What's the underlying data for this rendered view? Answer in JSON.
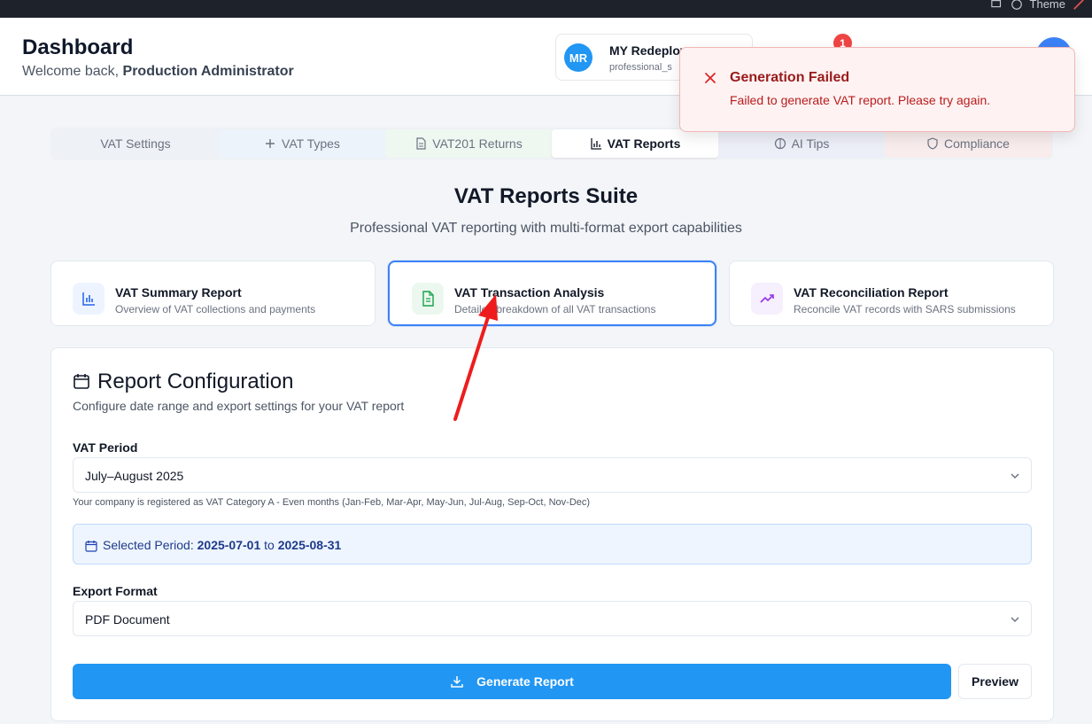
{
  "topbar": {
    "theme_label": "Theme"
  },
  "header": {
    "title": "Dashboard",
    "welcome_prefix": "Welcome back,",
    "user_name": "Production Administrator",
    "company": {
      "initials": "MR",
      "name": "MY Redeploy",
      "plan": "professional_s"
    },
    "notifications_count": "1"
  },
  "toast": {
    "title": "Generation Failed",
    "message": "Failed to generate VAT report. Please try again."
  },
  "tabs": [
    {
      "label": "VAT Settings",
      "icon": "none"
    },
    {
      "label": "VAT Types",
      "icon": "plus-icon"
    },
    {
      "label": "VAT201 Returns",
      "icon": "file-icon"
    },
    {
      "label": "VAT Reports",
      "icon": "bar-chart-icon",
      "active": true
    },
    {
      "label": "AI Tips",
      "icon": "brain-icon"
    },
    {
      "label": "Compliance",
      "icon": "shield-icon"
    }
  ],
  "suite": {
    "title": "VAT Reports Suite",
    "subtitle": "Professional VAT reporting with multi-format export capabilities"
  },
  "report_types": [
    {
      "title": "VAT Summary Report",
      "description": "Overview of VAT collections and payments",
      "icon": "bar-chart-icon",
      "color": "#2563eb"
    },
    {
      "title": "VAT Transaction Analysis",
      "description": "Detailed breakdown of all VAT transactions",
      "icon": "file-text-icon",
      "color": "#16a34a",
      "selected": true
    },
    {
      "title": "VAT Reconciliation Report",
      "description": "Reconcile VAT records with SARS submissions",
      "icon": "trending-up-icon",
      "color": "#9333ea"
    }
  ],
  "config": {
    "title": "Report Configuration",
    "subtitle": "Configure date range and export settings for your VAT report",
    "period_label": "VAT Period",
    "period_value": "July–August 2025",
    "period_hint": "Your company is registered as VAT Category A - Even months (Jan-Feb, Mar-Apr, May-Jun, Jul-Aug, Sep-Oct, Nov-Dec)",
    "selected_period_prefix": "Selected Period:",
    "period_start": "2025-07-01",
    "period_to": "to",
    "period_end": "2025-08-31",
    "format_label": "Export Format",
    "format_value": "PDF Document",
    "generate_label": "Generate Report",
    "preview_label": "Preview"
  },
  "colors": {
    "accent": "#2196f3",
    "error": "#991b1b",
    "selected_border": "#3b82f6"
  }
}
